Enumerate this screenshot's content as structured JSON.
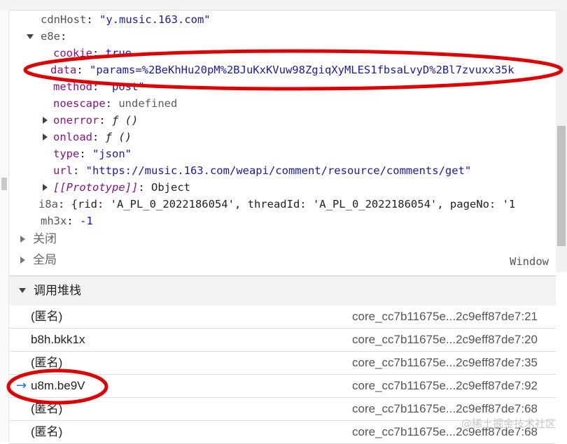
{
  "scope": {
    "lines": [
      {
        "key": "cdnHost",
        "value": "\"y.music.163.com\""
      },
      {
        "key": "e8e",
        "value": ""
      },
      {
        "key": "cookie",
        "value": "true"
      },
      {
        "key": "data",
        "value": "\"params=%2BeKhHu20pM%2BJuKxKVuw98ZgiqXyMLES1fbsaLvyD%2Bl7zvuxx35k"
      },
      {
        "key": "method",
        "value": "\"post\""
      },
      {
        "key": "noescape",
        "value": "undefined"
      },
      {
        "key": "onerror",
        "value": "ƒ ()"
      },
      {
        "key": "onload",
        "value": "ƒ ()"
      },
      {
        "key": "type",
        "value": "\"json\""
      },
      {
        "key": "url",
        "value": "\"https://music.163.com/weapi/comment/resource/comments/get\""
      },
      {
        "key": "[[Prototype]]",
        "value": "Object"
      },
      {
        "key": "i8a",
        "value": "{rid: 'A_PL_0_2022186054', threadId: 'A_PL_0_2022186054', pageNo: '1"
      },
      {
        "key": "mh3x",
        "value": "-1"
      }
    ],
    "closure_label": "关闭",
    "global_label": "全局",
    "global_value": "Window"
  },
  "callstack": {
    "title": "调用堆栈",
    "frames": [
      {
        "name": "(匿名)",
        "location": "core_cc7b11675e...2c9eff87de7:21"
      },
      {
        "name": "b8h.bkk1x",
        "location": "core_cc7b11675e...2c9eff87de7:20"
      },
      {
        "name": "(匿名)",
        "location": "core_cc7b11675e...2c9eff87de7:35"
      },
      {
        "name": "u8m.be9V",
        "location": "core_cc7b11675e...2c9eff87de7:92"
      },
      {
        "name": "(匿名)",
        "location": "core_cc7b11675e...2c9eff87de7:68"
      },
      {
        "name": "(匿名)",
        "location": "core_cc7b11675e...2c9eff87de7:68"
      }
    ]
  },
  "watermark": "@稀土掘金技术社区",
  "annotation_color": "#e00000"
}
